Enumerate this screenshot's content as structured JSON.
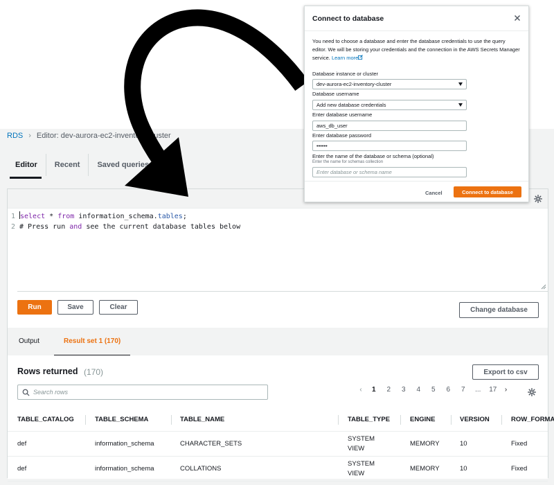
{
  "breadcrumb": {
    "root": "RDS",
    "current": "Editor: dev-aurora-ec2-inventory-cluster"
  },
  "tabs": [
    {
      "label": "Editor",
      "active": true
    },
    {
      "label": "Recent",
      "active": false
    },
    {
      "label": "Saved queries",
      "active": false
    }
  ],
  "editor": {
    "lines": [
      {
        "number": "1",
        "parts": [
          {
            "t": "select",
            "c": "kw"
          },
          {
            "t": " * ",
            "c": ""
          },
          {
            "t": "from",
            "c": "kw"
          },
          {
            "t": " information_schema.",
            "c": ""
          },
          {
            "t": "tables",
            "c": "fn"
          },
          {
            "t": ";",
            "c": ""
          }
        ]
      },
      {
        "number": "2",
        "parts": [
          {
            "t": "# Press run ",
            "c": ""
          },
          {
            "t": "and",
            "c": "kw"
          },
          {
            "t": " see the current database tables below",
            "c": ""
          }
        ]
      }
    ],
    "run_label": "Run",
    "save_label": "Save",
    "clear_label": "Clear",
    "change_db_label": "Change database"
  },
  "result_tabs": [
    {
      "label": "Output",
      "active": false
    },
    {
      "label": "Result set 1 (170)",
      "active": true
    }
  ],
  "rows": {
    "title": "Rows returned",
    "count": "(170)",
    "export_label": "Export to csv",
    "search_placeholder": "Search rows"
  },
  "pagination": {
    "prev": "‹",
    "next": "›",
    "items": [
      "1",
      "2",
      "3",
      "4",
      "5",
      "6",
      "7",
      "...",
      "17"
    ],
    "active": "1"
  },
  "table": {
    "columns": [
      "TABLE_CATALOG",
      "TABLE_SCHEMA",
      "TABLE_NAME",
      "TABLE_TYPE",
      "ENGINE",
      "VERSION",
      "ROW_FORMAT"
    ],
    "rows": [
      [
        "def",
        "information_schema",
        "CHARACTER_SETS",
        "SYSTEM VIEW",
        "MEMORY",
        "10",
        "Fixed"
      ],
      [
        "def",
        "information_schema",
        "COLLATIONS",
        "SYSTEM VIEW",
        "MEMORY",
        "10",
        "Fixed"
      ]
    ]
  },
  "modal": {
    "title": "Connect to database",
    "description": "You need to choose a database and enter the database credentials to use the query editor. We will be storing your credentials and the connection in the AWS Secrets Manager service.",
    "learn_more": "Learn more",
    "instance_label": "Database instance or cluster",
    "instance_value": "dev-aurora-ec2-inventory-cluster",
    "username_label": "Database username",
    "username_value": "Add new database credentials",
    "enter_username_label": "Enter database username",
    "enter_username_value": "aws_db_user",
    "password_label": "Enter database password",
    "password_value": "••••••",
    "dbname_label": "Enter the name of the database or schema (optional)",
    "dbname_description": "Enter the name for schemas collection",
    "dbname_placeholder": "Enter database or schema name",
    "cancel_label": "Cancel",
    "connect_label": "Connect to database"
  },
  "colors": {
    "accent": "#ec7211",
    "link": "#0073bb",
    "keyword": "#7d24a8",
    "function": "#2a59a8"
  }
}
